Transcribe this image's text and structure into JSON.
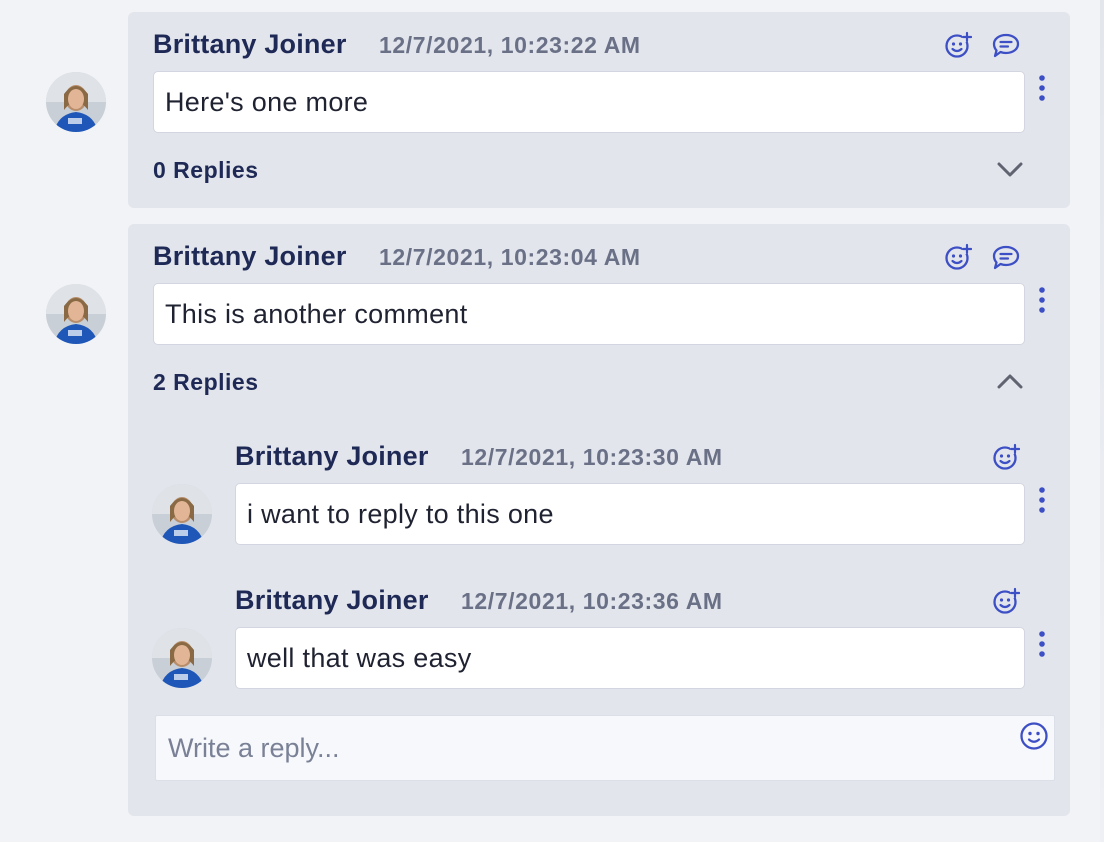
{
  "comments": [
    {
      "author": "Brittany Joiner",
      "timestamp": "12/7/2021, 10:23:22 AM",
      "text": "Here's one more",
      "replies_label": "0 Replies",
      "expanded": false,
      "icons": [
        "add-reaction-icon",
        "reply-comment-icon",
        "more-options-icon",
        "chevron-down-icon"
      ]
    },
    {
      "author": "Brittany Joiner",
      "timestamp": "12/7/2021, 10:23:04 AM",
      "text": "This is another comment",
      "replies_label": "2 Replies",
      "expanded": true,
      "icons": [
        "add-reaction-icon",
        "reply-comment-icon",
        "more-options-icon",
        "chevron-up-icon"
      ],
      "replies": [
        {
          "author": "Brittany Joiner",
          "timestamp": "12/7/2021, 10:23:30 AM",
          "text": "i want to reply to this one"
        },
        {
          "author": "Brittany Joiner",
          "timestamp": "12/7/2021, 10:23:36 AM",
          "text": "well that was easy"
        }
      ]
    }
  ],
  "reply_box": {
    "placeholder": "Write a reply...",
    "icon": "emoji-icon"
  },
  "colors": {
    "page_bg": "#f2f3f7",
    "card_bg": "#e3e5ed",
    "author": "#1e2a55",
    "timestamp": "#6a7187",
    "icon_accent": "#3d4fc4",
    "chevron": "#606470"
  }
}
